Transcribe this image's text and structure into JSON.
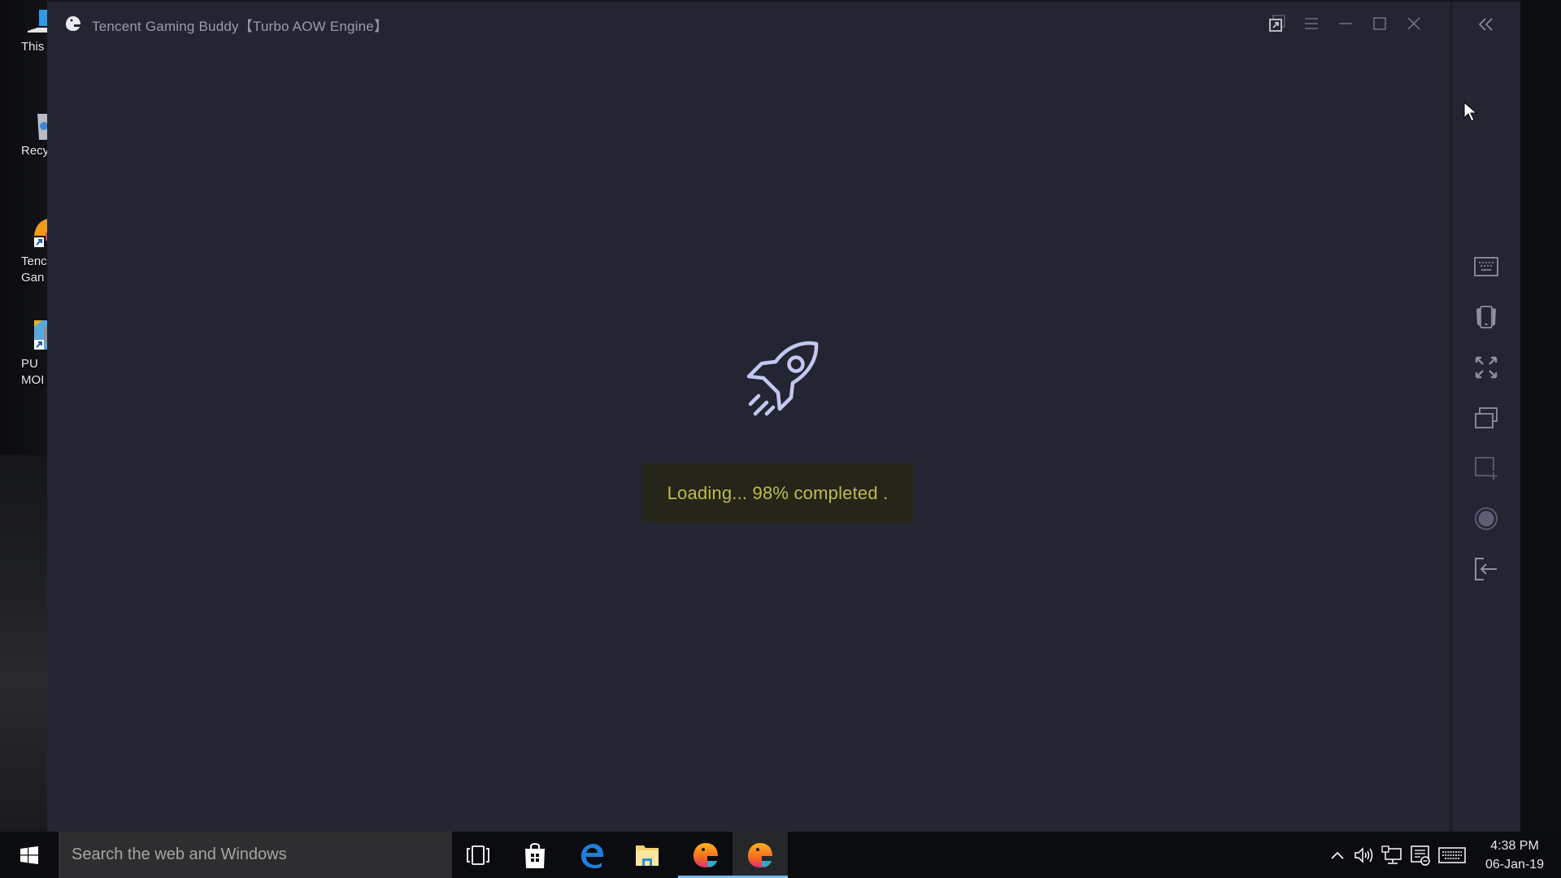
{
  "desktop": {
    "icons": [
      {
        "name": "this-pc",
        "label": "This"
      },
      {
        "name": "recycle-bin",
        "label": "Recyc"
      },
      {
        "name": "tencent-gaming-buddy",
        "label": "Tenc\nGan"
      },
      {
        "name": "pubg-mobile",
        "label": "PU\nMOI"
      }
    ]
  },
  "window": {
    "title": "Tencent Gaming Buddy【Turbo AOW Engine】",
    "controls": [
      "popout",
      "menu",
      "minimize",
      "maximize",
      "close",
      "collapse-sidebar"
    ]
  },
  "sidebar": {
    "tools": [
      "keyboard-mapping",
      "shake-device",
      "fullscreen",
      "multi-window",
      "screenshot",
      "record",
      "exit-game"
    ]
  },
  "loading": {
    "progress_percent": 98,
    "text": "Loading... 98% completed ."
  },
  "colors": {
    "window_bg": "#232533",
    "loading_text": "#bdbd4a",
    "loading_bg": "#25251a",
    "rocket": "#c3c8f0"
  },
  "taskbar": {
    "search_placeholder": "Search the web and Windows",
    "apps": [
      "task-view",
      "store",
      "edge",
      "file-explorer",
      "tencent-gaming-buddy",
      "tencent-gaming-buddy-engine"
    ],
    "tray": [
      "show-hidden-icons",
      "volume",
      "network",
      "action-center",
      "touch-keyboard"
    ],
    "time": "4:38 PM",
    "date": "06-Jan-19"
  }
}
